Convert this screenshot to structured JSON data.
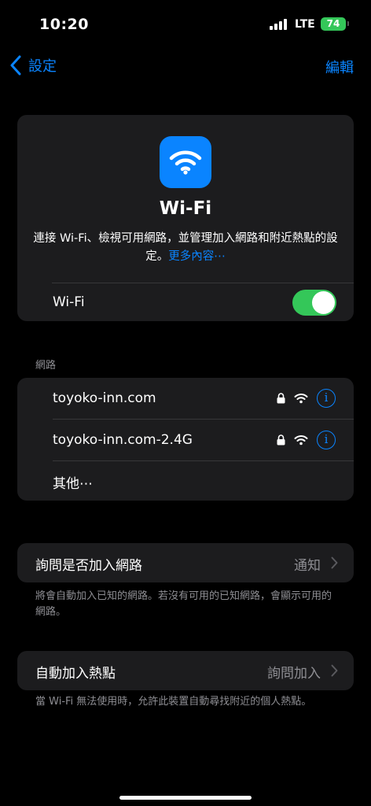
{
  "status_bar": {
    "time": "10:20",
    "carrier": "LTE",
    "battery": "74"
  },
  "nav": {
    "back_label": "設定",
    "edit_label": "編輯"
  },
  "hero": {
    "title": "Wi-Fi",
    "description": "連接 Wi-Fi、檢視可用網路，並管理加入網路和附近熱點的設定。",
    "more_link": "更多內容⋯",
    "toggle_label": "Wi-Fi",
    "toggle_on": true,
    "icon": "wifi-icon"
  },
  "networks": {
    "header": "網路",
    "items": [
      {
        "name": "toyoko-inn.com",
        "secured": true
      },
      {
        "name": "toyoko-inn.com-2.4G",
        "secured": true
      }
    ],
    "other_label": "其他⋯"
  },
  "ask_to_join": {
    "label": "詢問是否加入網路",
    "value": "通知",
    "footer": "將會自動加入已知的網路。若沒有可用的已知網路，會顯示可用的網路。"
  },
  "auto_hotspot": {
    "label": "自動加入熱點",
    "value": "詢問加入",
    "footer": "當 Wi-Fi 無法使用時，允許此裝置自動尋找附近的個人熱點。"
  },
  "colors": {
    "accent": "#0a84ff",
    "toggle_on": "#34c759",
    "cell": "#1c1c1e",
    "secondary_text": "#8e8e93"
  }
}
